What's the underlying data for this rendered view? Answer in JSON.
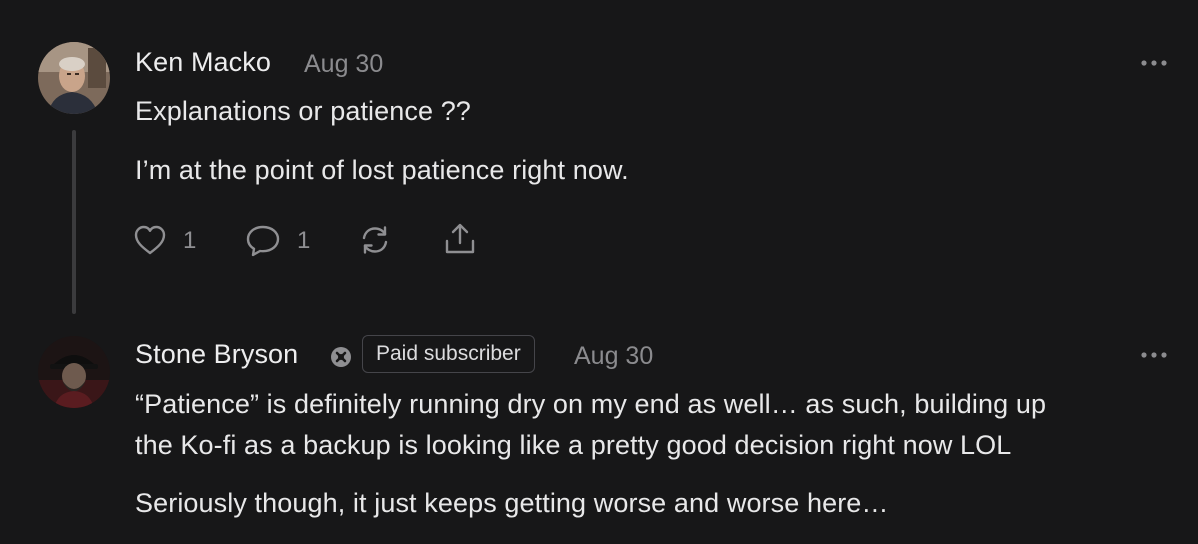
{
  "comments": [
    {
      "author": "Ken Macko",
      "date": "Aug 30",
      "paragraphs": [
        "Explanations or patience ??",
        "I’m at the point of lost patience right now."
      ],
      "likes": "1",
      "replies": "1"
    },
    {
      "author": "Stone Bryson",
      "badge": "Paid subscriber",
      "date": "Aug 30",
      "paragraphs": [
        "“Patience” is definitely running dry on my end as well… as such, building up",
        "the Ko-fi as a backup is looking like a pretty good decision right now LOL",
        "Seriously though, it just keeps getting worse and worse here…"
      ]
    }
  ],
  "colors": {
    "background": "#171718",
    "text": "#e8e8e9",
    "muted": "#8b8b8e",
    "thread_line": "#3b3b3d"
  },
  "icons": {
    "like": "heart-icon",
    "reply": "comment-bubble-icon",
    "restack": "restack-icon",
    "share": "share-icon",
    "more": "ellipsis-icon",
    "badge": "subscriber-badge-icon"
  }
}
